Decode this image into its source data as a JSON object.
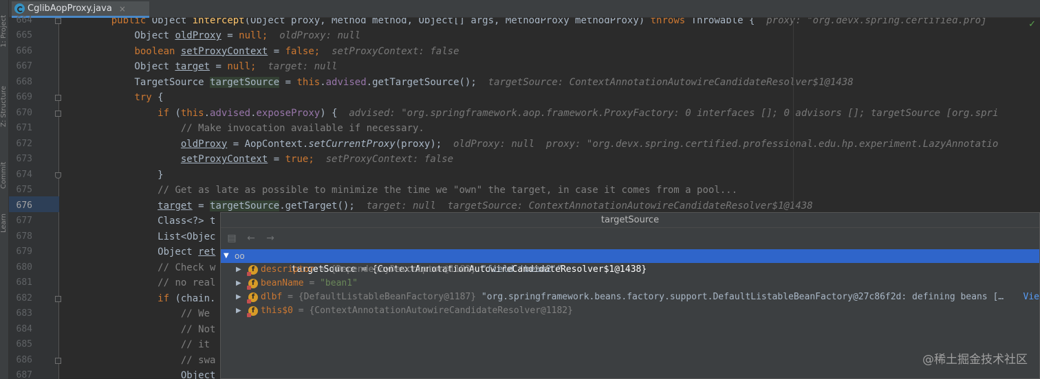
{
  "editor_tab": {
    "filename": "CglibAopProxy.java",
    "close": "×"
  },
  "side_tools": [
    "1: Project",
    "Z: Structure",
    "Commit",
    "Learn"
  ],
  "current_line": "676",
  "lines": [
    {
      "num": "664",
      "parts": [
        {
          "t": "    "
        },
        {
          "t": "public ",
          "c": "kw"
        },
        {
          "t": "Object "
        },
        {
          "t": "intercept",
          "c": "mth"
        },
        {
          "t": "(Object proxy, Method method, Object[] args, MethodProxy methodProxy) "
        },
        {
          "t": "throws ",
          "c": "kw"
        },
        {
          "t": "Throwable {  "
        },
        {
          "t": "proxy: \"org.devx.spring.certified.proj",
          "c": "inl"
        }
      ]
    },
    {
      "num": "665",
      "parts": [
        {
          "t": "        Object "
        },
        {
          "t": "oldProxy",
          "c": "und"
        },
        {
          "t": " = "
        },
        {
          "t": "null",
          "c": "kw"
        },
        {
          "t": ";  ",
          "c": "kw"
        },
        {
          "t": "oldProxy: null",
          "c": "inl"
        }
      ]
    },
    {
      "num": "666",
      "parts": [
        {
          "t": "        "
        },
        {
          "t": "boolean ",
          "c": "kw"
        },
        {
          "t": "setProxyContext",
          "c": "und"
        },
        {
          "t": " = "
        },
        {
          "t": "false",
          "c": "kw"
        },
        {
          "t": ";  ",
          "c": "kw"
        },
        {
          "t": "setProxyContext: false",
          "c": "inl"
        }
      ]
    },
    {
      "num": "667",
      "parts": [
        {
          "t": "        Object "
        },
        {
          "t": "target",
          "c": "und"
        },
        {
          "t": " = "
        },
        {
          "t": "null",
          "c": "kw"
        },
        {
          "t": ";  ",
          "c": "kw"
        },
        {
          "t": "target: null",
          "c": "inl"
        }
      ]
    },
    {
      "num": "668",
      "parts": [
        {
          "t": "        TargetSource "
        },
        {
          "t": "targetSource",
          "c": "mark"
        },
        {
          "t": " = "
        },
        {
          "t": "this",
          "c": "kw"
        },
        {
          "t": "."
        },
        {
          "t": "advised",
          "c": "fld"
        },
        {
          "t": ".getTargetSource();  "
        },
        {
          "t": "targetSource: ContextAnnotationAutowireCandidateResolver$1@1438",
          "c": "inl"
        }
      ]
    },
    {
      "num": "669",
      "parts": [
        {
          "t": "        "
        },
        {
          "t": "try ",
          "c": "kw"
        },
        {
          "t": "{"
        }
      ]
    },
    {
      "num": "670",
      "parts": [
        {
          "t": "            "
        },
        {
          "t": "if ",
          "c": "kw"
        },
        {
          "t": "("
        },
        {
          "t": "this",
          "c": "kw"
        },
        {
          "t": "."
        },
        {
          "t": "advised",
          "c": "fld"
        },
        {
          "t": "."
        },
        {
          "t": "exposeProxy",
          "c": "fld"
        },
        {
          "t": ") {  "
        },
        {
          "t": "advised: \"org.springframework.aop.framework.ProxyFactory: 0 interfaces []; 0 advisors []; targetSource [org.spri",
          "c": "inl"
        }
      ]
    },
    {
      "num": "671",
      "parts": [
        {
          "t": "                "
        },
        {
          "t": "// Make invocation available if necessary.",
          "c": "cm"
        }
      ]
    },
    {
      "num": "672",
      "parts": [
        {
          "t": "                "
        },
        {
          "t": "oldProxy",
          "c": "und"
        },
        {
          "t": " = AopContext."
        },
        {
          "t": "setCurrentProxy",
          "c": "ital"
        },
        {
          "t": "(proxy);  "
        },
        {
          "t": "oldProxy: null  proxy: \"org.devx.spring.certified.professional.edu.hp.experiment.LazyAnnotatio",
          "c": "inl"
        }
      ]
    },
    {
      "num": "673",
      "parts": [
        {
          "t": "                "
        },
        {
          "t": "setProxyContext",
          "c": "und"
        },
        {
          "t": " = "
        },
        {
          "t": "true",
          "c": "kw"
        },
        {
          "t": ";  ",
          "c": "kw"
        },
        {
          "t": "setProxyContext: false",
          "c": "inl"
        }
      ]
    },
    {
      "num": "674",
      "parts": [
        {
          "t": "            }"
        }
      ]
    },
    {
      "num": "675",
      "parts": [
        {
          "t": "            "
        },
        {
          "t": "// Get as late as possible to minimize the time we \"own\" the target, in case it comes from a pool...",
          "c": "cm"
        }
      ]
    },
    {
      "num": "676",
      "parts": [
        {
          "t": "            "
        },
        {
          "t": "target",
          "c": "und"
        },
        {
          "t": " = "
        },
        {
          "t": "targetSource",
          "c": "mark"
        },
        {
          "t": ".getTarget();  "
        },
        {
          "t": "target: null  targetSource: ContextAnnotationAutowireCandidateResolver$1@1438",
          "c": "inl"
        }
      ]
    },
    {
      "num": "677",
      "parts": [
        {
          "t": "            Class<?> t"
        }
      ]
    },
    {
      "num": "678",
      "parts": [
        {
          "t": "            List<Objec"
        }
      ]
    },
    {
      "num": "679",
      "parts": [
        {
          "t": "            Object "
        },
        {
          "t": "ret",
          "c": "und"
        }
      ]
    },
    {
      "num": "680",
      "parts": [
        {
          "t": "            "
        },
        {
          "t": "// Check w",
          "c": "cm"
        }
      ]
    },
    {
      "num": "681",
      "parts": [
        {
          "t": "            "
        },
        {
          "t": "// no real",
          "c": "cm"
        }
      ]
    },
    {
      "num": "682",
      "parts": [
        {
          "t": "            "
        },
        {
          "t": "if ",
          "c": "kw"
        },
        {
          "t": "(chain."
        }
      ]
    },
    {
      "num": "683",
      "parts": [
        {
          "t": "                "
        },
        {
          "t": "// We",
          "c": "cm"
        }
      ]
    },
    {
      "num": "684",
      "parts": [
        {
          "t": "                "
        },
        {
          "t": "// Not",
          "c": "cm"
        }
      ]
    },
    {
      "num": "685",
      "parts": [
        {
          "t": "                "
        },
        {
          "t": "// it",
          "c": "cm"
        }
      ]
    },
    {
      "num": "686",
      "parts": [
        {
          "t": "                "
        },
        {
          "t": "// swa",
          "c": "cm"
        }
      ]
    },
    {
      "num": "687",
      "parts": [
        {
          "t": "                Object"
        }
      ]
    }
  ],
  "popup": {
    "title": "targetSource",
    "toolbar": {
      "back": "←",
      "forward": "→"
    },
    "root": {
      "name": "targetSource",
      "value": " = {ContextAnnotationAutowireCandidateResolver$1@1438}"
    },
    "children": [
      {
        "name": "descriptor",
        "ref": " = {DependencyDescriptor@1183} ",
        "val": "\"field 'bean2'\""
      },
      {
        "name": "beanName",
        "ref": " = ",
        "val": "\"bean1\""
      },
      {
        "name": "dlbf",
        "ref": " = {DefaultListableBeanFactory@1187} ",
        "val": "\"org.springframework.beans.factory.support.DefaultListableBeanFactory@27c86f2d: defining beans [… ",
        "link": "Vie"
      },
      {
        "name": "this$0",
        "ref": " = {ContextAnnotationAutowireCandidateResolver@1182}",
        "val": ""
      }
    ]
  },
  "watermark": "@稀土掘金技术社区"
}
